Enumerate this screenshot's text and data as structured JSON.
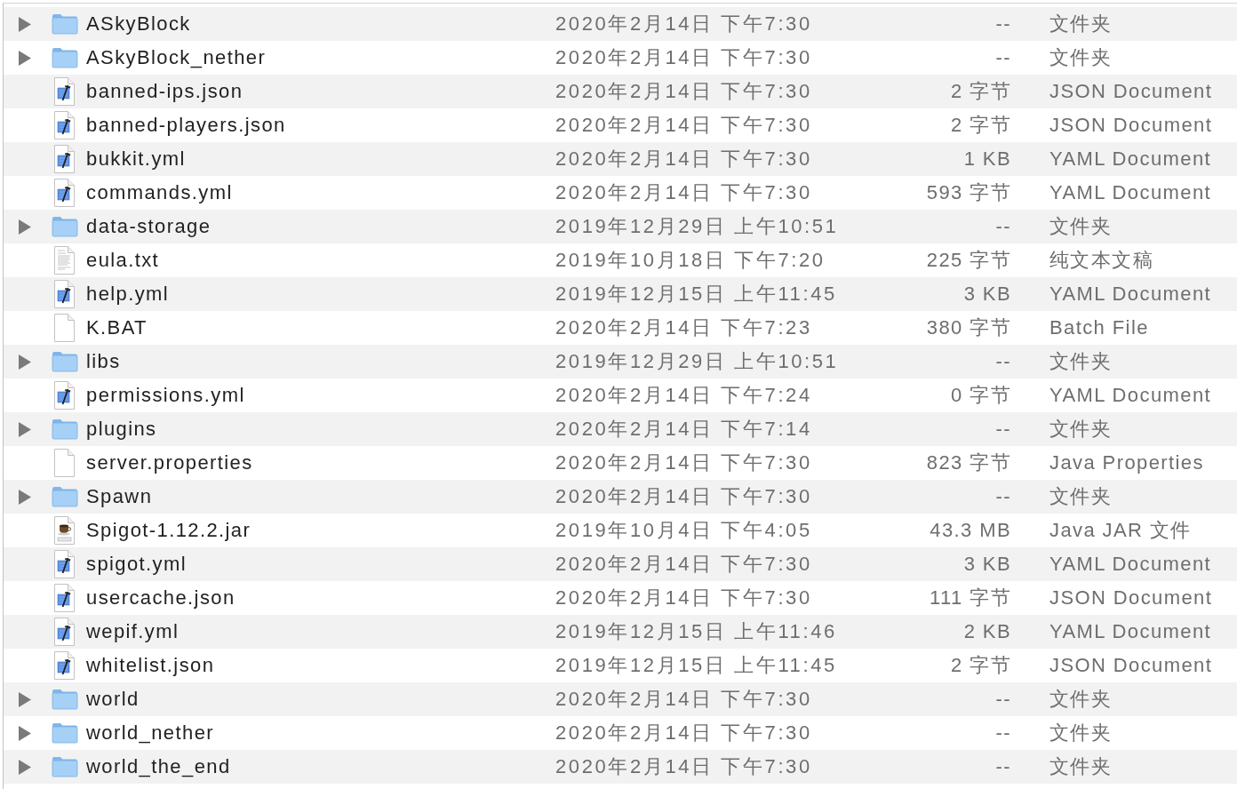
{
  "files": [
    {
      "name": "ASkyBlock",
      "kind": "folder",
      "expanded": false,
      "date_modified": "2020年2月14日 下午7:30",
      "size": "--",
      "file_type": "文件夹"
    },
    {
      "name": "ASkyBlock_nether",
      "kind": "folder",
      "expanded": false,
      "date_modified": "2020年2月14日 下午7:30",
      "size": "--",
      "file_type": "文件夹"
    },
    {
      "name": "banned-ips.json",
      "kind": "script",
      "date_modified": "2020年2月14日 下午7:30",
      "size": "2 字节",
      "file_type": "JSON Document"
    },
    {
      "name": "banned-players.json",
      "kind": "script",
      "date_modified": "2020年2月14日 下午7:30",
      "size": "2 字节",
      "file_type": "JSON Document"
    },
    {
      "name": "bukkit.yml",
      "kind": "script",
      "date_modified": "2020年2月14日 下午7:30",
      "size": "1 KB",
      "file_type": "YAML Document"
    },
    {
      "name": "commands.yml",
      "kind": "script",
      "date_modified": "2020年2月14日 下午7:30",
      "size": "593 字节",
      "file_type": "YAML Document"
    },
    {
      "name": "data-storage",
      "kind": "folder",
      "expanded": false,
      "date_modified": "2019年12月29日 上午10:51",
      "size": "--",
      "file_type": "文件夹"
    },
    {
      "name": "eula.txt",
      "kind": "text",
      "date_modified": "2019年10月18日 下午7:20",
      "size": "225 字节",
      "file_type": "纯文本文稿"
    },
    {
      "name": "help.yml",
      "kind": "script",
      "date_modified": "2019年12月15日 上午11:45",
      "size": "3 KB",
      "file_type": "YAML Document"
    },
    {
      "name": "K.BAT",
      "kind": "blank",
      "date_modified": "2020年2月14日 下午7:23",
      "size": "380 字节",
      "file_type": "Batch File"
    },
    {
      "name": "libs",
      "kind": "folder",
      "expanded": false,
      "date_modified": "2019年12月29日 上午10:51",
      "size": "--",
      "file_type": "文件夹"
    },
    {
      "name": "permissions.yml",
      "kind": "script",
      "date_modified": "2020年2月14日 下午7:24",
      "size": "0 字节",
      "file_type": "YAML Document"
    },
    {
      "name": "plugins",
      "kind": "folder",
      "expanded": false,
      "date_modified": "2020年2月14日 下午7:14",
      "size": "--",
      "file_type": "文件夹"
    },
    {
      "name": "server.properties",
      "kind": "blank",
      "date_modified": "2020年2月14日 下午7:30",
      "size": "823 字节",
      "file_type": "Java Properties"
    },
    {
      "name": "Spawn",
      "kind": "folder",
      "expanded": false,
      "date_modified": "2020年2月14日 下午7:30",
      "size": "--",
      "file_type": "文件夹"
    },
    {
      "name": "Spigot-1.12.2.jar",
      "kind": "jar",
      "date_modified": "2019年10月4日 下午4:05",
      "size": "43.3 MB",
      "file_type": "Java JAR 文件"
    },
    {
      "name": "spigot.yml",
      "kind": "script",
      "date_modified": "2020年2月14日 下午7:30",
      "size": "3 KB",
      "file_type": "YAML Document"
    },
    {
      "name": "usercache.json",
      "kind": "script",
      "date_modified": "2020年2月14日 下午7:30",
      "size": "111 字节",
      "file_type": "JSON Document"
    },
    {
      "name": "wepif.yml",
      "kind": "script",
      "date_modified": "2019年12月15日 上午11:46",
      "size": "2 KB",
      "file_type": "YAML Document"
    },
    {
      "name": "whitelist.json",
      "kind": "script",
      "date_modified": "2019年12月15日 上午11:45",
      "size": "2 字节",
      "file_type": "JSON Document"
    },
    {
      "name": "world",
      "kind": "folder",
      "expanded": false,
      "date_modified": "2020年2月14日 下午7:30",
      "size": "--",
      "file_type": "文件夹"
    },
    {
      "name": "world_nether",
      "kind": "folder",
      "expanded": false,
      "date_modified": "2020年2月14日 下午7:30",
      "size": "--",
      "file_type": "文件夹"
    },
    {
      "name": "world_the_end",
      "kind": "folder",
      "expanded": false,
      "date_modified": "2020年2月14日 下午7:30",
      "size": "--",
      "file_type": "文件夹"
    }
  ]
}
